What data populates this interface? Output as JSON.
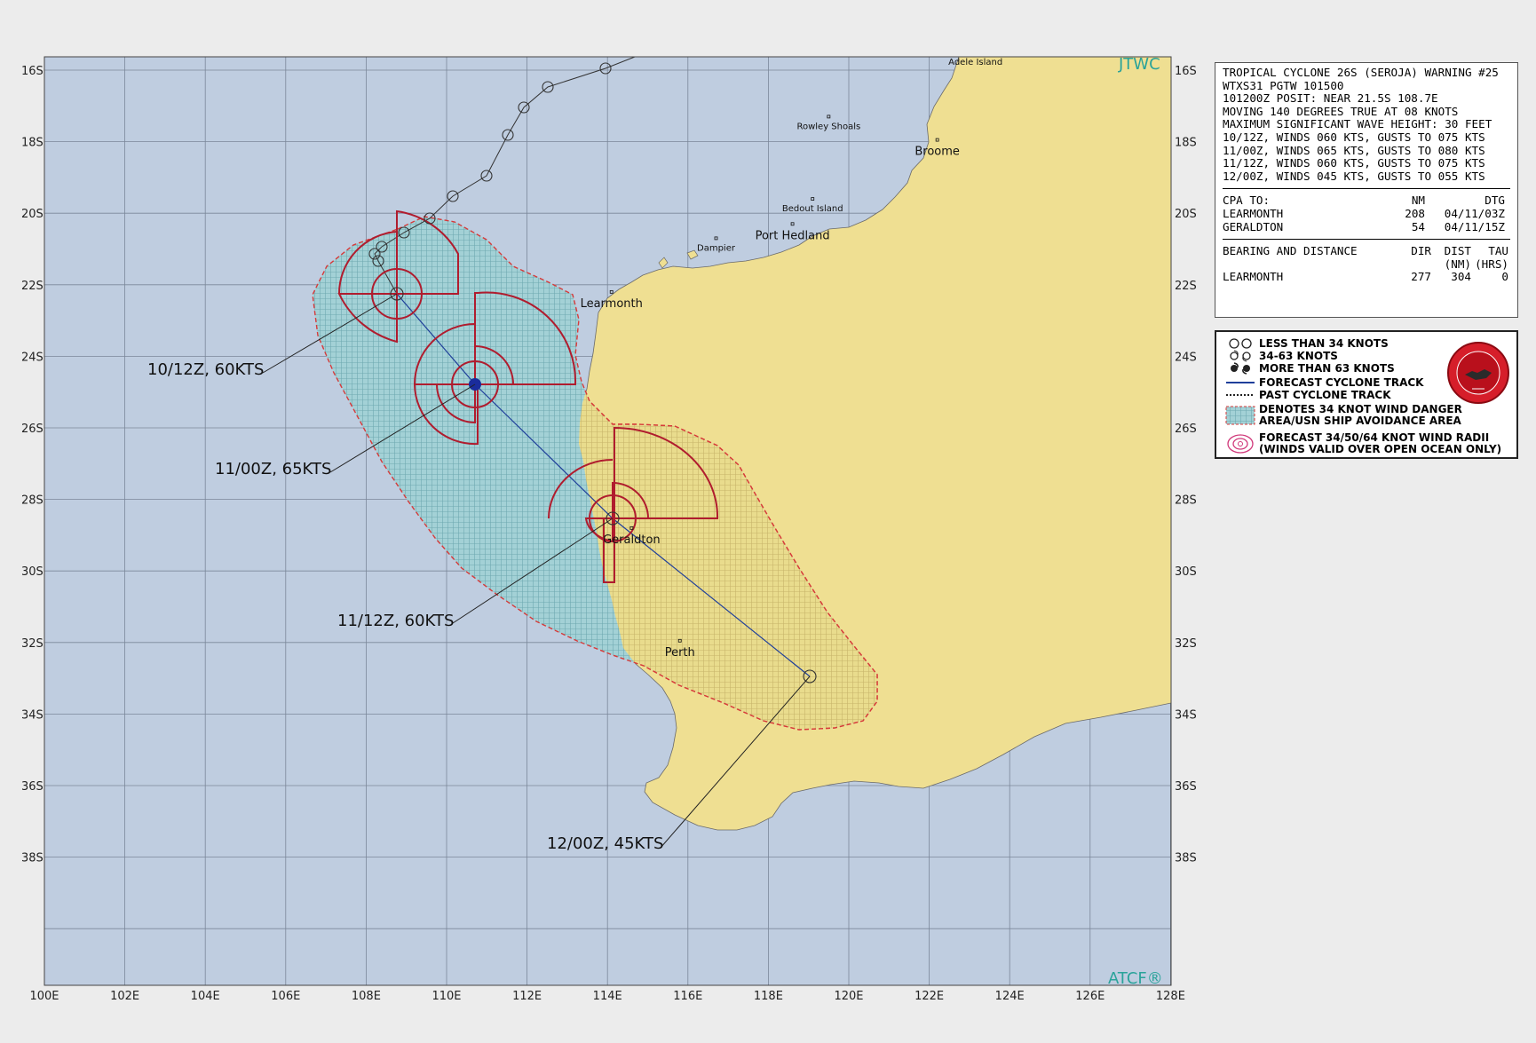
{
  "brand": {
    "top_right": "JTWC",
    "bottom_right": "ATCF®"
  },
  "lat_labels": [
    "16S",
    "18S",
    "20S",
    "22S",
    "24S",
    "26S",
    "28S",
    "30S",
    "32S",
    "34S",
    "36S",
    "38S"
  ],
  "lon_labels": [
    "100E",
    "102E",
    "104E",
    "106E",
    "108E",
    "110E",
    "112E",
    "114E",
    "116E",
    "118E",
    "120E",
    "122E",
    "124E",
    "126E",
    "128E"
  ],
  "places": [
    {
      "name": "Adele Island",
      "lon": 123.15,
      "lat": -15.5,
      "size": "small"
    },
    {
      "name": "Rowley Shoals",
      "lon": 119.5,
      "lat": -17.3,
      "size": "small"
    },
    {
      "name": "Broome",
      "lon": 122.2,
      "lat": -17.95,
      "size": "large"
    },
    {
      "name": "Bedout Island",
      "lon": 119.1,
      "lat": -19.6,
      "size": "small"
    },
    {
      "name": "Port Hedland",
      "lon": 118.6,
      "lat": -20.3,
      "size": "large"
    },
    {
      "name": "Dampier",
      "lon": 116.7,
      "lat": -20.7,
      "size": "small"
    },
    {
      "name": "Learmonth",
      "lon": 114.1,
      "lat": -22.2,
      "size": "large"
    },
    {
      "name": "Geraldton",
      "lon": 114.6,
      "lat": -28.8,
      "size": "large"
    },
    {
      "name": "Perth",
      "lon": 115.8,
      "lat": -31.95,
      "size": "large"
    }
  ],
  "forecast_labels": [
    {
      "text": "10/12Z, 60KTS"
    },
    {
      "text": "11/00Z, 65KTS"
    },
    {
      "text": "11/12Z, 60KTS"
    },
    {
      "text": "12/00Z, 45KTS"
    }
  ],
  "warning": {
    "lines": [
      "TROPICAL CYCLONE 26S (SEROJA) WARNING #25",
      "WTXS31 PGTW 101500",
      "101200Z POSIT: NEAR 21.5S 108.7E",
      "MOVING 140 DEGREES TRUE AT 08 KNOTS",
      "MAXIMUM SIGNIFICANT WAVE HEIGHT: 30 FEET",
      "10/12Z, WINDS 060 KTS, GUSTS TO 075 KTS",
      "11/00Z, WINDS 065 KTS, GUSTS TO 080 KTS",
      "11/12Z, WINDS 060 KTS, GUSTS TO 075 KTS",
      "12/00Z, WINDS 045 KTS, GUSTS TO 055 KTS"
    ],
    "cpa": {
      "header": [
        "CPA TO:",
        "NM",
        "DTG"
      ],
      "rows": [
        [
          "LEARMONTH",
          "208",
          "04/11/03Z"
        ],
        [
          "GERALDTON",
          "54",
          "04/11/15Z"
        ]
      ]
    },
    "bearing": {
      "header1": [
        "BEARING AND DISTANCE",
        "DIR",
        "DIST",
        "TAU"
      ],
      "header2": [
        "",
        "",
        "(NM)",
        "(HRS)"
      ],
      "rows": [
        [
          "LEARMONTH",
          "277",
          "304",
          "0"
        ]
      ]
    }
  },
  "legend": {
    "items": [
      "LESS THAN 34 KNOTS",
      "34-63 KNOTS",
      "MORE THAN 63 KNOTS",
      "FORECAST CYCLONE TRACK",
      "PAST CYCLONE TRACK",
      "DENOTES 34 KNOT WIND DANGER\nAREA/USN SHIP AVOIDANCE AREA",
      "FORECAST 34/50/64 KNOT WIND RADII\n(WINDS VALID OVER OPEN OCEAN ONLY)"
    ]
  },
  "colors": {
    "ocean": "#bfcde0",
    "land": "#efdf92",
    "grid": "#7b8799",
    "danger_ocean": "#9fd0d4",
    "danger_land": "#e6d88c",
    "danger_border": "#d63a3a",
    "wind_radii": "#b01c2e",
    "track": "#1f3f9a",
    "current_position": "#1a2c9c"
  }
}
